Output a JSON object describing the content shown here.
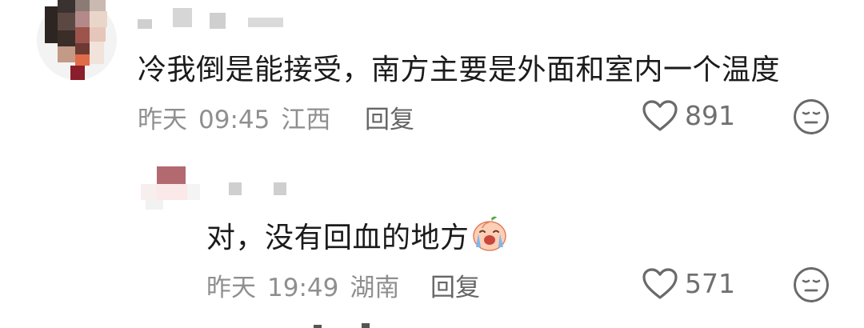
{
  "comments": [
    {
      "text": "冷我倒是能接受，南方主要是外面和室内一个温度",
      "date": "昨天",
      "time": "09:45",
      "location": "江西",
      "reply_label": "回复",
      "likes": "891"
    },
    {
      "text": "对，没有回血的地方",
      "date": "昨天",
      "time": "19:49",
      "location": "湖南",
      "reply_label": "回复",
      "likes": "571"
    }
  ],
  "icons": {
    "like": "heart-icon",
    "dislike": "meh-face-icon",
    "emoji": "crying-peach-emoji"
  },
  "colors": {
    "text": "#1b1b1b",
    "meta": "#8f8f8f",
    "icon": "#6a6a6a"
  }
}
